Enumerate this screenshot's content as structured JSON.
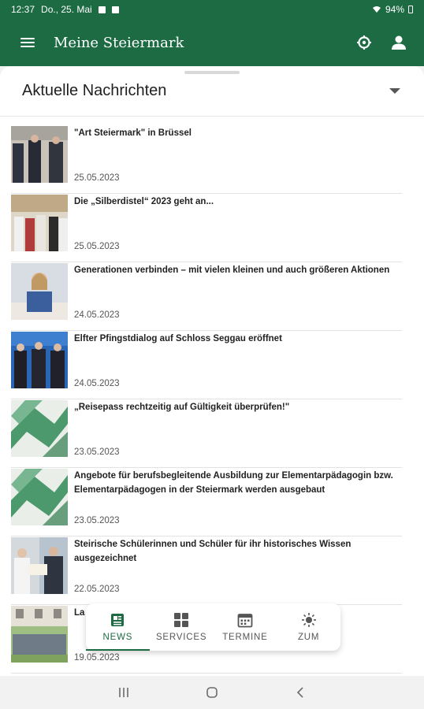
{
  "status": {
    "time": "12:37",
    "date": "Do., 25. Mai",
    "battery": "94%"
  },
  "app": {
    "title": "Meine Steiermark"
  },
  "section": {
    "title": "Aktuelle Nachrichten"
  },
  "news": [
    {
      "title": "\"Art Steiermark\" in Brüssel",
      "date": "25.05.2023"
    },
    {
      "title": "Die „Silberdistel“ 2023 geht an...",
      "date": "25.05.2023"
    },
    {
      "title": "Generationen verbinden – mit vielen kleinen und auch größeren Aktionen",
      "date": "24.05.2023"
    },
    {
      "title": "Elfter Pfingstdialog auf Schloss Seggau eröffnet",
      "date": "24.05.2023"
    },
    {
      "title": "„Reisepass rechtzeitig auf Gültigkeit überprüfen!\"",
      "date": "23.05.2023"
    },
    {
      "title": "Angebote für berufsbegleitende Ausbildung zur Elementarpädagogin bzw. Elementarpädagogen in der Steiermark werden ausgebaut",
      "date": "23.05.2023"
    },
    {
      "title": "Steirische Schülerinnen und Schüler für ihr historisches Wissen ausgezeichnet",
      "date": "22.05.2023"
    },
    {
      "title": "La",
      "date": "19.05.2023"
    }
  ],
  "bottom_nav": {
    "items": [
      {
        "label": "NEWS",
        "icon": "news-icon",
        "active": true
      },
      {
        "label": "SERVICES",
        "icon": "grid-icon"
      },
      {
        "label": "TERMINE",
        "icon": "calendar-icon"
      },
      {
        "label": "ZUM",
        "icon": "sun-icon"
      }
    ]
  },
  "colors": {
    "brand": "#1d6b43",
    "header_bg": "#1d6b43"
  }
}
